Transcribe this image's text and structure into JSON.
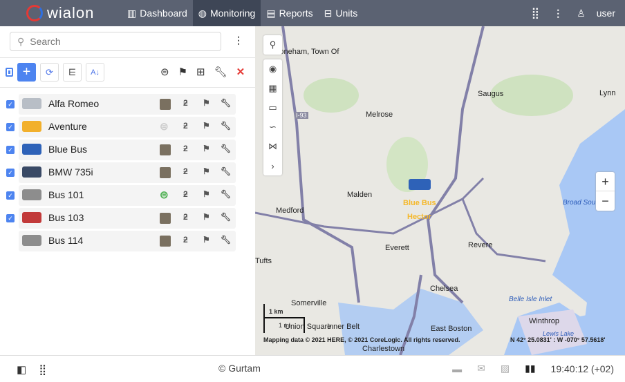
{
  "header": {
    "logo": "wialon",
    "nav": [
      {
        "label": "Dashboard",
        "icon": "bar-chart-icon"
      },
      {
        "label": "Monitoring",
        "icon": "globe-icon",
        "active": true
      },
      {
        "label": "Reports",
        "icon": "clipboard-icon"
      },
      {
        "label": "Units",
        "icon": "bus-icon"
      }
    ],
    "user": "user"
  },
  "sidebar": {
    "search_placeholder": "Search",
    "search_value": "",
    "units": [
      {
        "name": "Alfa Romeo",
        "checked": true,
        "icon_color": "#b8bec6",
        "driver": "photo"
      },
      {
        "name": "Aventure",
        "checked": true,
        "icon_color": "#f2b02c",
        "driver": "none"
      },
      {
        "name": "Blue Bus",
        "checked": true,
        "icon_color": "#2e62b8",
        "driver": "photo"
      },
      {
        "name": "BMW 735i",
        "checked": true,
        "icon_color": "#3a4a66",
        "driver": "photo"
      },
      {
        "name": "Bus 101",
        "checked": true,
        "icon_color": "#8d8d8d",
        "driver": "assigned"
      },
      {
        "name": "Bus 103",
        "checked": true,
        "icon_color": "#c23a3a",
        "driver": "photo"
      },
      {
        "name": "Bus 114",
        "checked": false,
        "icon_color": "#8d8d8d",
        "driver": "photo"
      }
    ]
  },
  "map": {
    "labels": [
      "Stoneham, Town Of",
      "Saugus",
      "Lynn",
      "Melrose",
      "Malden",
      "Medford",
      "Everett",
      "Revere",
      "Tufts",
      "Somerville",
      "Chelsea",
      "East Boston",
      "Winthrop",
      "Charlestown",
      "Union Square",
      "Inner Belt",
      "Belle Isle Inlet",
      "Broad Sou",
      "Lewis Lake",
      "I-93"
    ],
    "unit_label": "Blue Bus",
    "driver_label": "Hector",
    "scale": "1 km",
    "scale2": "1 mi",
    "attribution": "Mapping data © 2021 HERE, © 2021 CoreLogic. All rights reserved.",
    "coords": "N 42° 25.0831' : W -070° 57.5618'"
  },
  "footer": {
    "copyright": "© Gurtam",
    "time": "19:40:12 (+02)"
  },
  "colors": {
    "accent": "#4d84f0",
    "header": "#5b6272",
    "active_nav": "#3e4656",
    "danger": "#e53935"
  }
}
